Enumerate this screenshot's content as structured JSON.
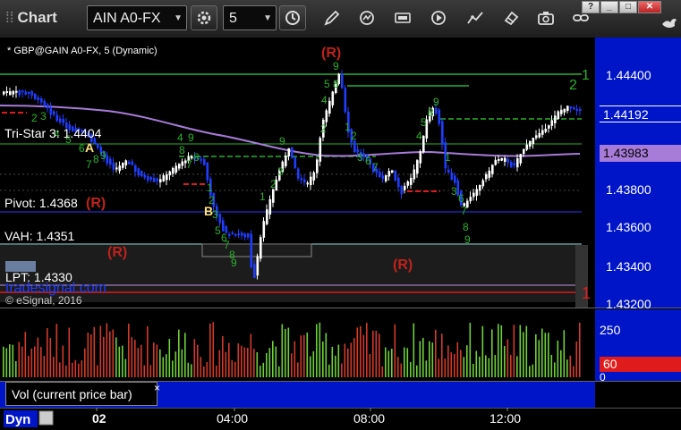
{
  "toolbar": {
    "title": "Chart",
    "symbol": "AIN A0-FX",
    "interval": "5",
    "icons": [
      "gear-icon",
      "clock-icon",
      "pencil-icon",
      "refresh-icon",
      "calculator-icon",
      "play-icon",
      "eraser-icon",
      "camera-icon",
      "link-icon",
      "bird-icon"
    ],
    "window_buttons": [
      "?",
      "_",
      "□",
      "✕"
    ]
  },
  "chart": {
    "caption": "* GBP@GAIN A0-FX, 5 (Dynamic)",
    "copyright": "© eSignal, 2016",
    "watermark": "tradesignal.com",
    "levels": {
      "tristar": "Tri-Star 3: 1.4404",
      "pivot": "Pivot: 1.4368",
      "vah": "VAH: 1.4351",
      "lpt": "LPT: 1.4330"
    },
    "markers": [
      "(R)",
      "(R)",
      "(R)",
      "(R)",
      "A",
      "B"
    ],
    "counts_right": [
      "1",
      "2",
      "1"
    ],
    "price_axis": [
      "1.44400",
      "1.44192",
      "1.43983",
      "1.43800",
      "1.43600",
      "1.43400",
      "1.43200"
    ],
    "current_price": "1.44192",
    "ma_price": "1.43983",
    "colors": {
      "up": "#ffffff",
      "down": "#1f3dff",
      "ma": "#a77bd8",
      "green_level": "#2bb12b",
      "red_level": "#e01b1b",
      "axis_blue": "#0015c8"
    }
  },
  "volume": {
    "axis": [
      "250",
      "60",
      "0"
    ],
    "current": "60",
    "panel_label": "Vol (current price bar)",
    "close": "×"
  },
  "time_axis": {
    "mode": "Dyn",
    "labels": [
      "02",
      "04:00",
      "08:00",
      "12:00"
    ]
  }
}
